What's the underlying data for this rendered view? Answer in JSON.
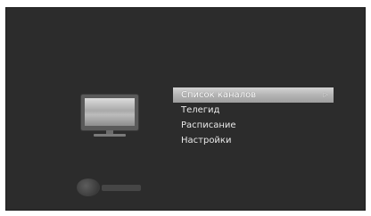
{
  "menu": {
    "items": [
      {
        "label": "Список каналов",
        "selected": true
      },
      {
        "label": "Телегид",
        "selected": false
      },
      {
        "label": "Расписание",
        "selected": false
      },
      {
        "label": "Настройки",
        "selected": false
      }
    ],
    "selected_indicator": "▷"
  },
  "icons": {
    "tv": "tv-icon",
    "brand": "brand-logo"
  },
  "colors": {
    "background": "#2c2c2c",
    "text": "#e8e8e8",
    "highlight": "#b4b4b4"
  }
}
